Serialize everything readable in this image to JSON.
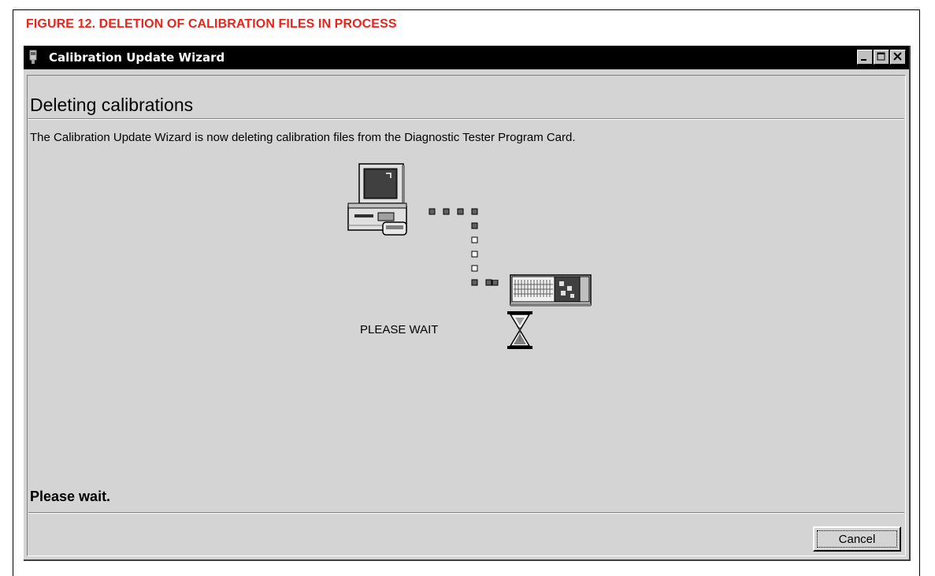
{
  "figure_caption": "FIGURE 12.  DELETION OF CALIBRATION FILES IN PROCESS",
  "window": {
    "title": "Calibration Update Wizard",
    "controls": [
      "minimize",
      "maximize",
      "close"
    ]
  },
  "page": {
    "heading": "Deleting calibrations",
    "description": "The Calibration Update Wizard is now deleting calibration files from the Diagnostic Tester Program Card.",
    "animation_label": "PLEASE WAIT",
    "status": "Please wait."
  },
  "buttons": {
    "cancel_label": "Cancel"
  },
  "icons": {
    "computer": "computer-icon",
    "tester": "diagnostic-tester-icon",
    "hourglass": "hourglass-icon",
    "path": "transfer-path-dots"
  },
  "colors": {
    "caption": "#e8241c",
    "titlebar": "#000000",
    "window_face": "#d4d4d4"
  }
}
